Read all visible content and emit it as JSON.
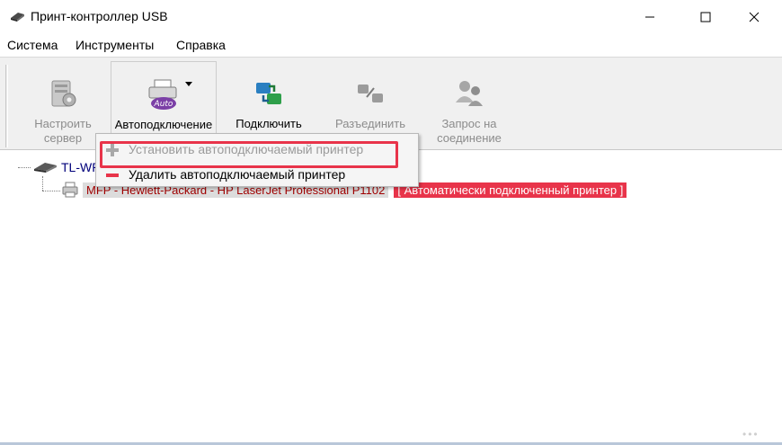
{
  "window": {
    "title": "Принт-контроллер USB"
  },
  "menu": [
    "Система",
    "Инструменты",
    "Справка"
  ],
  "toolbar": {
    "configure": {
      "line1": "Настроить",
      "line2": "сервер"
    },
    "autoconnect": {
      "label": "Автоподключение",
      "badge": "Auto"
    },
    "connect": {
      "label": "Подключить"
    },
    "disconnect": {
      "line1": "Разъединить",
      "line2": ""
    },
    "request": {
      "line1": "Запрос на",
      "line2": "соединение"
    }
  },
  "dropdown": {
    "items": [
      {
        "label": "Установить автоподключаемый принтер",
        "enabled": false,
        "icon": "plus-icon"
      },
      {
        "label": "Удалить автоподключаемый принтер",
        "enabled": true,
        "icon": "minus-icon"
      }
    ]
  },
  "tree": {
    "server": {
      "label": "TL-WR"
    },
    "printer": {
      "label": "MFP - Hewlett-Packard - HP LaserJet Professional P1102",
      "status": "[ Автоматически подключенный принтер ]"
    }
  },
  "colors": {
    "highlight": "#e8344a",
    "toolbar_bg": "#f0f0f0",
    "server_text": "#00007a",
    "printer_text": "#a00000"
  },
  "watermark": "•••"
}
